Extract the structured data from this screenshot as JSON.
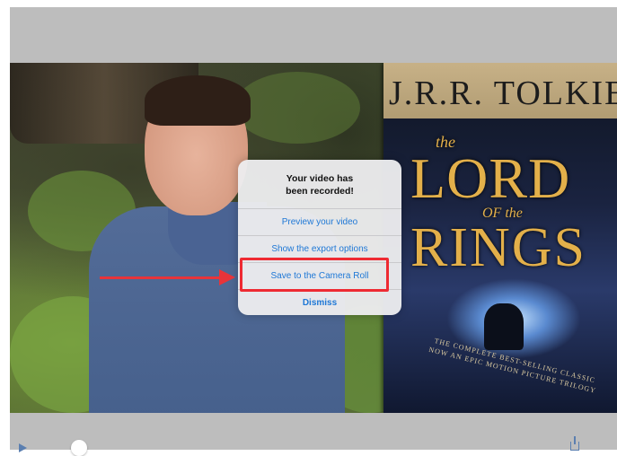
{
  "alert": {
    "title_line1": "Your video has",
    "title_line2": "been recorded!",
    "buttons": [
      {
        "label": "Preview your video"
      },
      {
        "label": "Show the export options"
      },
      {
        "label": "Save to the Camera Roll"
      },
      {
        "label": "Dismiss"
      }
    ]
  },
  "book": {
    "author": "J.R.R. TOLKIEN",
    "title_the": "the",
    "title_lord": "LORD",
    "title_of_the": "OF the",
    "title_rings": "RINGS",
    "blurb_line1": "THE COMPLETE BEST-SELLING CLASSIC",
    "blurb_line2": "NOW AN EPIC MOTION PICTURE TRILOGY"
  },
  "colors": {
    "accent": "#1f78d6",
    "highlight": "#ee2a32",
    "arrow": "#e8343a"
  },
  "icons": [
    "play-icon",
    "share-icon"
  ]
}
